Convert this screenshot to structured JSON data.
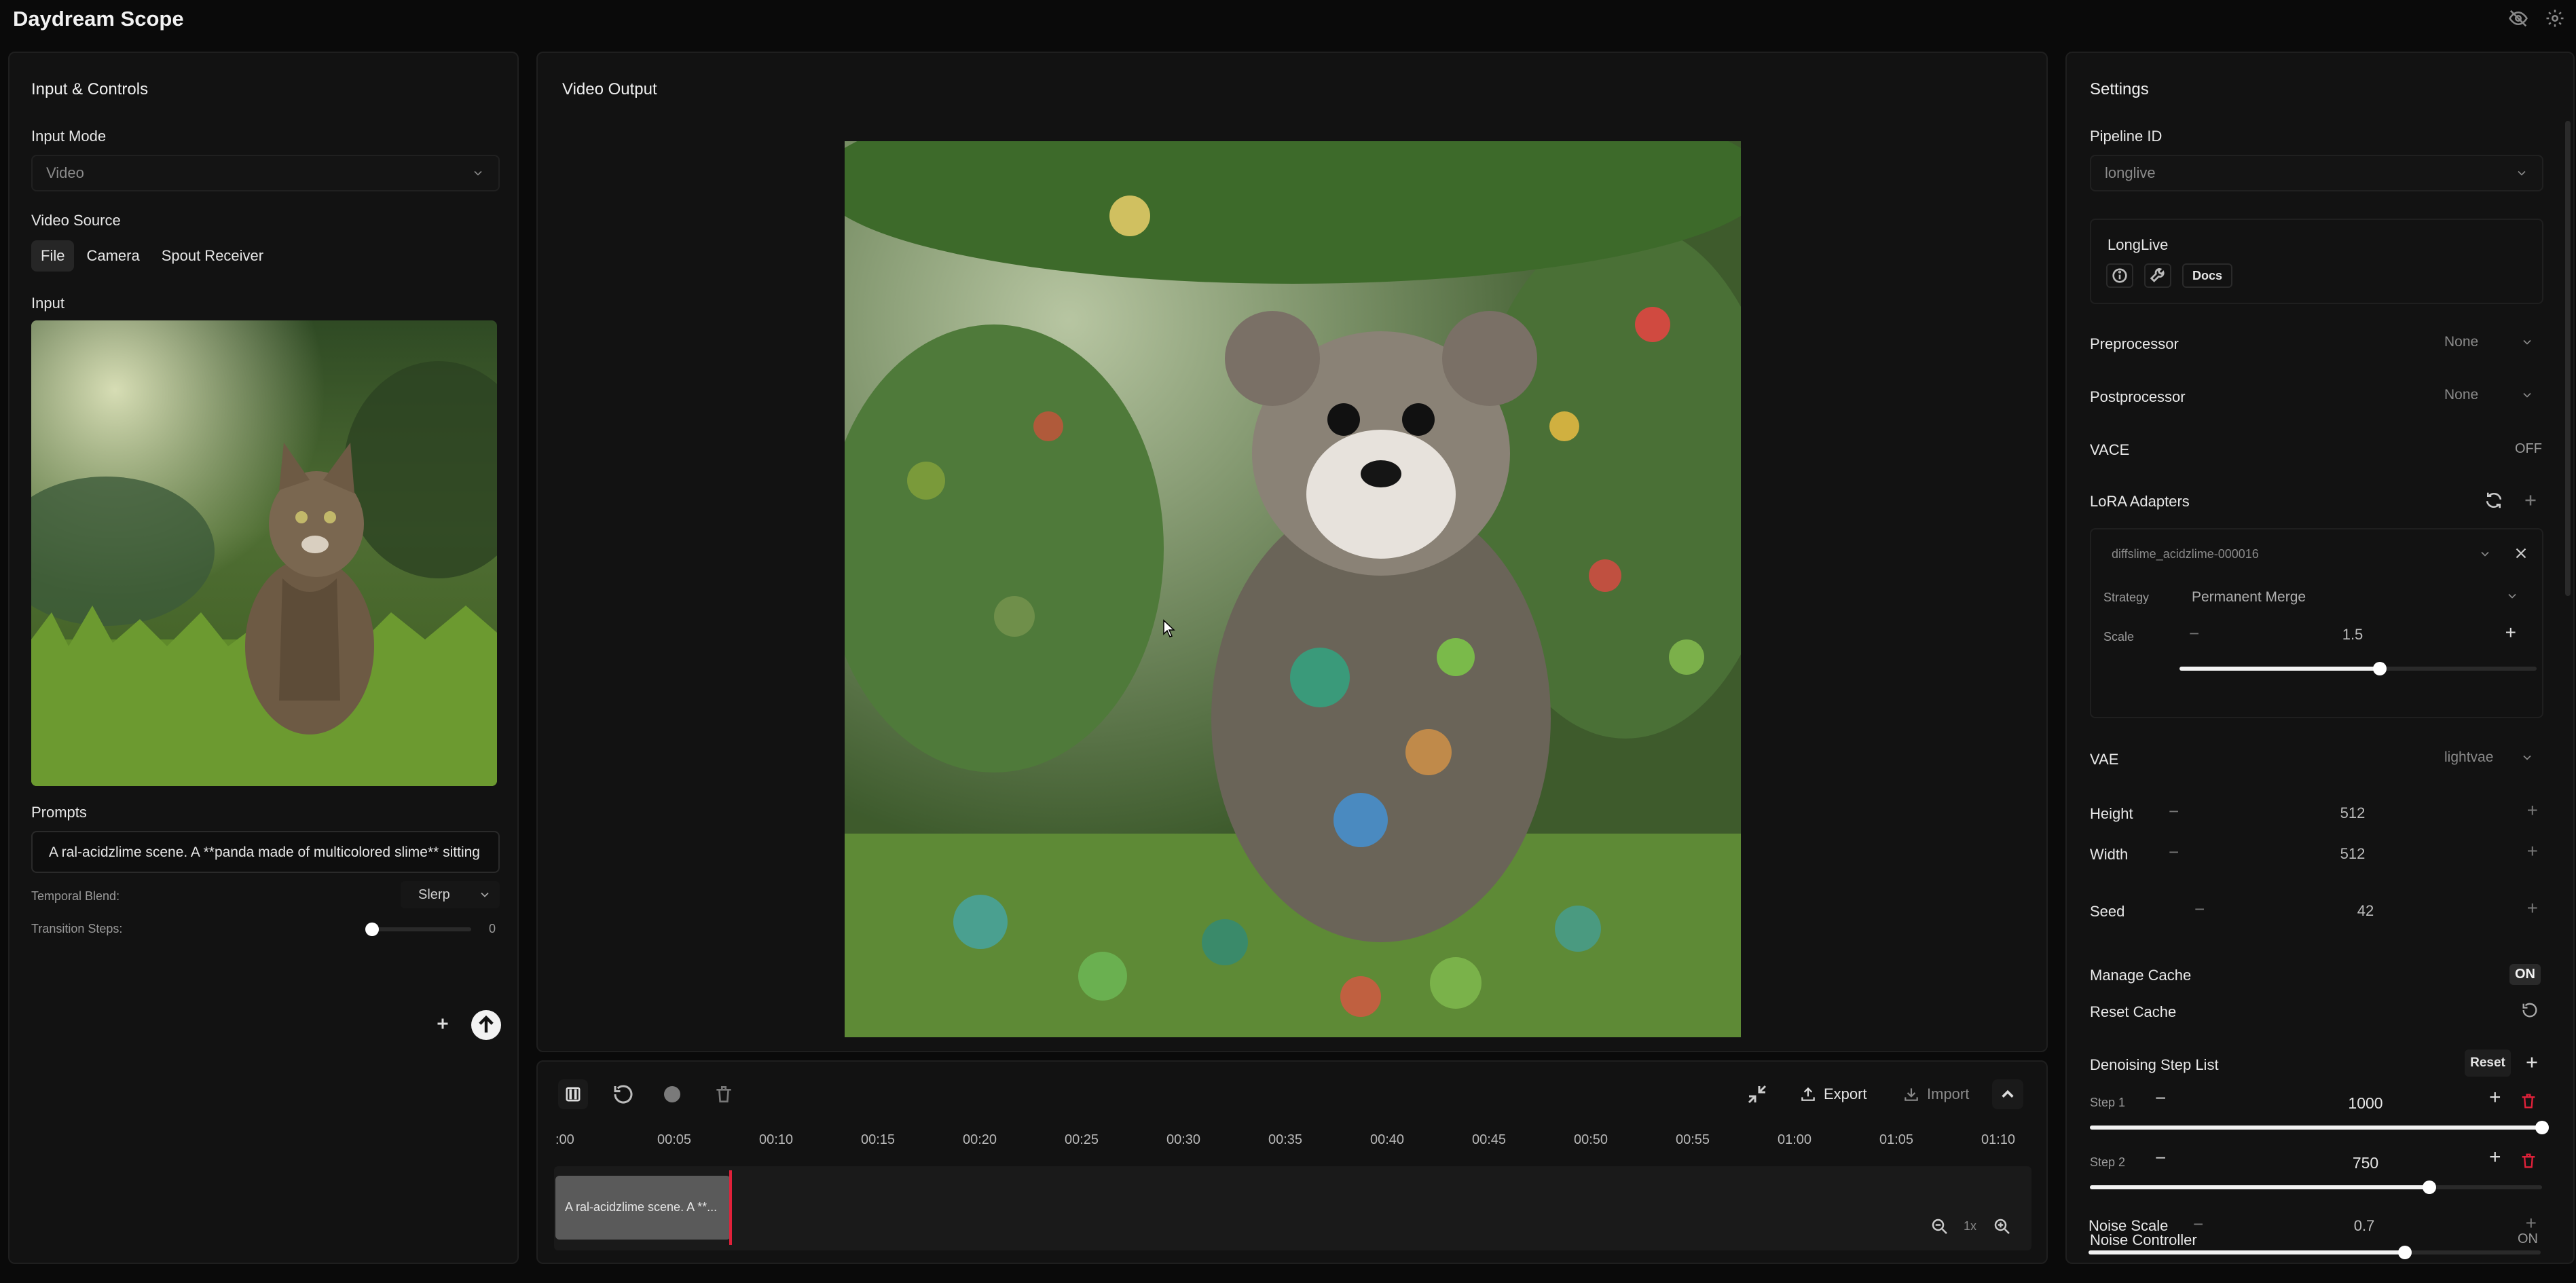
{
  "app": {
    "title": "Daydream Scope"
  },
  "icons": {
    "eye_off": "eye-off-icon",
    "settings": "gear-icon"
  },
  "left": {
    "title": "Input & Controls",
    "input_mode_label": "Input Mode",
    "input_mode_value": "Video",
    "video_source_label": "Video Source",
    "source_tabs": [
      "File",
      "Camera",
      "Spout Receiver"
    ],
    "active_source_tab": "File",
    "input_label": "Input",
    "prompts_label": "Prompts",
    "prompt_text": "A ral-acidzlime scene. A **panda made of multicolored slime** sitting",
    "temporal_blend_label": "Temporal Blend:",
    "temporal_blend_value": "Slerp",
    "transition_steps_label": "Transition Steps:",
    "transition_steps_value": "0"
  },
  "center": {
    "title": "Video Output",
    "timeline": {
      "ticks": [
        ":00",
        "00:05",
        "00:10",
        "00:15",
        "00:20",
        "00:25",
        "00:30",
        "00:35",
        "00:40",
        "00:45",
        "00:50",
        "00:55",
        "01:00",
        "01:05",
        "01:10"
      ],
      "clip_label": "A ral-acidzlime scene. A **...",
      "export_label": "Export",
      "import_label": "Import",
      "zoom_level": "1x"
    }
  },
  "settings": {
    "title": "Settings",
    "pipeline_id_label": "Pipeline ID",
    "pipeline_id_value": "longlive",
    "pipeline_card_name": "LongLive",
    "docs_label": "Docs",
    "preprocessor_label": "Preprocessor",
    "preprocessor_value": "None",
    "postprocessor_label": "Postprocessor",
    "postprocessor_value": "None",
    "vace_label": "VACE",
    "vace_value": "OFF",
    "lora_label": "LoRA Adapters",
    "lora_file": "diffslime_acidzlime-000016",
    "strategy_label": "Strategy",
    "strategy_value": "Permanent Merge",
    "scale_label": "Scale",
    "scale_value": "1.5",
    "scale_fraction": 0.56,
    "vae_label": "VAE",
    "vae_value": "lightvae",
    "height_label": "Height",
    "height_value": "512",
    "width_label": "Width",
    "width_value": "512",
    "seed_label": "Seed",
    "seed_value": "42",
    "manage_cache_label": "Manage Cache",
    "manage_cache_value": "ON",
    "reset_cache_label": "Reset Cache",
    "denoising_label": "Denoising Step List",
    "reset_label": "Reset",
    "steps": [
      {
        "label": "Step 1",
        "value": "1000",
        "fraction": 1.0
      },
      {
        "label": "Step 2",
        "value": "750",
        "fraction": 0.75
      }
    ],
    "noise_controller_label": "Noise Controller",
    "noise_controller_value": "ON",
    "noise_scale_label": "Noise Scale",
    "noise_scale_value": "0.7",
    "noise_scale_fraction": 0.7
  }
}
